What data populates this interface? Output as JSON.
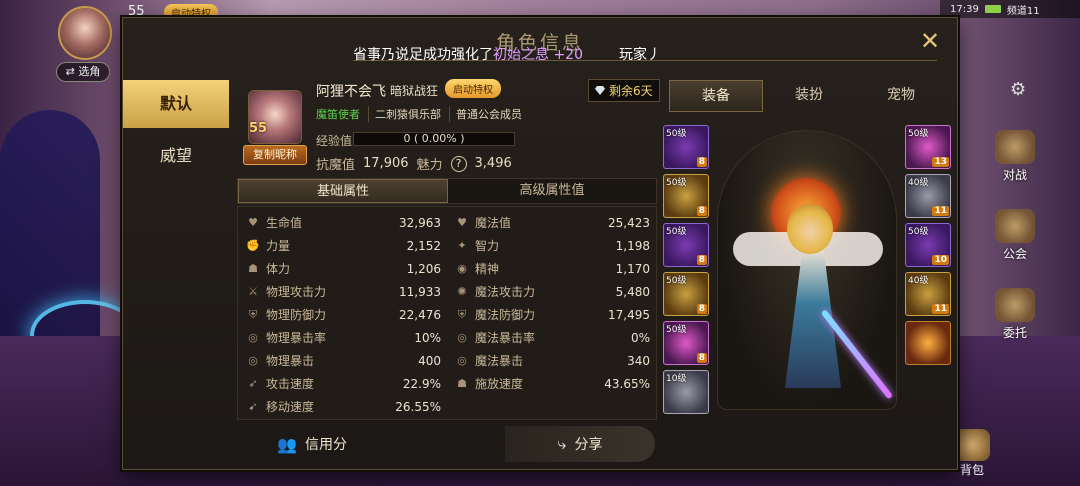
{
  "hud": {
    "level": "55",
    "tag": "启动特权",
    "switch_role": "⇄ 选角",
    "time": "17:39",
    "network": "频道11"
  },
  "side_menu": [
    {
      "label": "对战"
    },
    {
      "label": "公会"
    },
    {
      "label": "委托"
    }
  ],
  "bag_label": "背包",
  "panel": {
    "title": "角色信息",
    "close_glyph": "✕"
  },
  "ticker": {
    "prefix": "省事乃说足成功强化了",
    "item": "初始之息 +20",
    "suffix": "玩家丿"
  },
  "left_tabs": [
    {
      "label": "默认",
      "active": true
    },
    {
      "label": "威望",
      "active": false
    }
  ],
  "player": {
    "name": "阿狸不会飞",
    "class": "暗狱战狂",
    "vip": "启动特权",
    "level": "55",
    "copy_btn": "复制昵称",
    "title": "魔笛使者",
    "guild": "二刺猿俱乐部",
    "guild_role": "普通公会成员",
    "exp_label": "经验值",
    "exp_value": "0 ( 0.00% )",
    "resist_label": "抗魔值",
    "resist_value": "17,906",
    "charm_label": "魅力",
    "charm_value": "3,496",
    "remain": "剩余6天"
  },
  "attr_tabs": [
    {
      "label": "基础属性",
      "active": true
    },
    {
      "label": "高级属性值",
      "active": false
    }
  ],
  "attributes": [
    [
      {
        "icon": "♥",
        "name": "生命值",
        "value": "32,963"
      },
      {
        "icon": "♥",
        "name": "魔法值",
        "value": "25,423"
      }
    ],
    [
      {
        "icon": "✊",
        "name": "力量",
        "value": "2,152"
      },
      {
        "icon": "✦",
        "name": "智力",
        "value": "1,198"
      }
    ],
    [
      {
        "icon": "☗",
        "name": "体力",
        "value": "1,206"
      },
      {
        "icon": "◉",
        "name": "精神",
        "value": "1,170"
      }
    ],
    [
      {
        "icon": "⚔",
        "name": "物理攻击力",
        "value": "11,933"
      },
      {
        "icon": "✺",
        "name": "魔法攻击力",
        "value": "5,480"
      }
    ],
    [
      {
        "icon": "⛨",
        "name": "物理防御力",
        "value": "22,476"
      },
      {
        "icon": "⛨",
        "name": "魔法防御力",
        "value": "17,495"
      }
    ],
    [
      {
        "icon": "◎",
        "name": "物理暴击率",
        "value": "10%"
      },
      {
        "icon": "◎",
        "name": "魔法暴击率",
        "value": "0%"
      }
    ],
    [
      {
        "icon": "◎",
        "name": "物理暴击",
        "value": "400"
      },
      {
        "icon": "◎",
        "name": "魔法暴击",
        "value": "340"
      }
    ],
    [
      {
        "icon": "➶",
        "name": "攻击速度",
        "value": "22.9%"
      },
      {
        "icon": "☗",
        "name": "施放速度",
        "value": "43.65%"
      }
    ],
    [
      {
        "icon": "➹",
        "name": "移动速度",
        "value": "26.55%"
      },
      {
        "icon": "",
        "name": "",
        "value": ""
      }
    ]
  ],
  "bottom": {
    "credit": "信用分",
    "share": "分享"
  },
  "equip_tabs": [
    {
      "label": "装备",
      "active": true
    },
    {
      "label": "装扮",
      "active": false
    },
    {
      "label": "宠物",
      "active": false
    }
  ],
  "equip_left": [
    {
      "lv": "50级",
      "badge": "8",
      "style": "purple"
    },
    {
      "lv": "50级",
      "badge": "8",
      "style": "gold"
    },
    {
      "lv": "50级",
      "badge": "8",
      "style": "purple"
    },
    {
      "lv": "50级",
      "badge": "8",
      "style": "gold"
    },
    {
      "lv": "50级",
      "badge": "8",
      "style": "pink"
    },
    {
      "lv": "10级",
      "badge": "",
      "style": "gray"
    }
  ],
  "equip_right": [
    {
      "lv": "50级",
      "badge": "13",
      "style": "pink"
    },
    {
      "lv": "40级",
      "badge": "11",
      "style": "gray"
    },
    {
      "lv": "50级",
      "badge": "10",
      "style": "purple"
    },
    {
      "lv": "40级",
      "badge": "11",
      "style": "gold"
    },
    {
      "lv": "",
      "badge": "",
      "style": "fire"
    }
  ]
}
